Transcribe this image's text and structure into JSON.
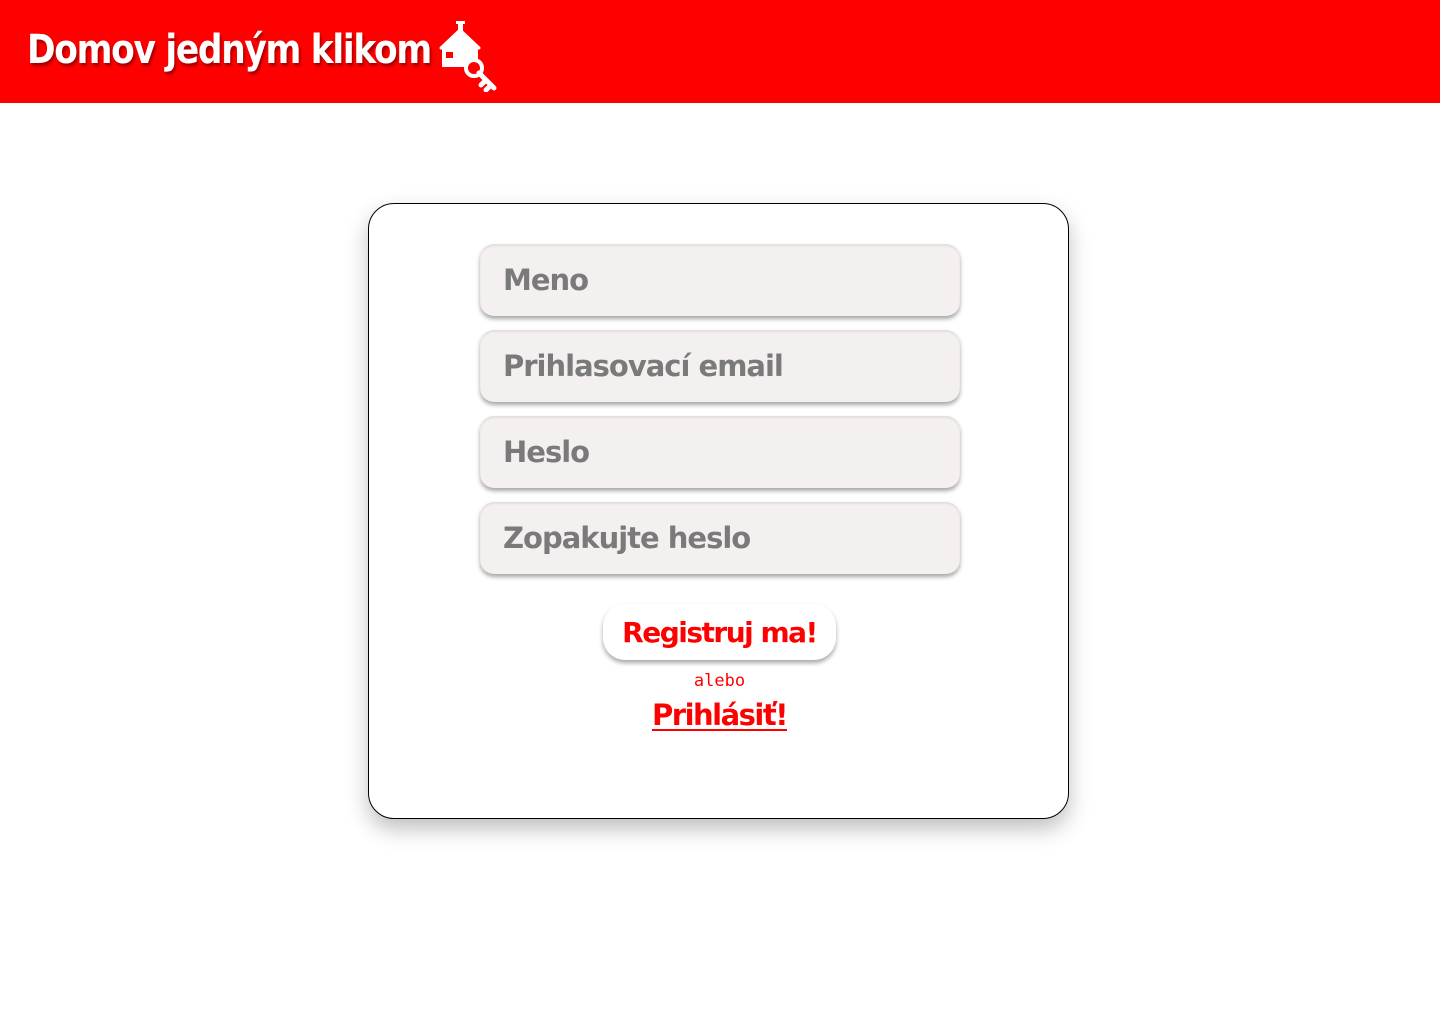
{
  "header": {
    "title": "Domov jedným klikom",
    "logo_icon": "house-key-icon",
    "background_color": "#ff0000",
    "text_color": "#ffffff"
  },
  "form": {
    "name_placeholder": "Meno",
    "email_placeholder": "Prihlasovací email",
    "password_placeholder": "Heslo",
    "repeat_password_placeholder": "Zopakujte heslo",
    "register_label": "Registruj ma!",
    "or_text": "alebo",
    "login_label": "Prihlásiť!"
  },
  "colors": {
    "accent": "#ff0000",
    "field_background": "#f5f0f0",
    "placeholder": "#7a7a7a"
  }
}
